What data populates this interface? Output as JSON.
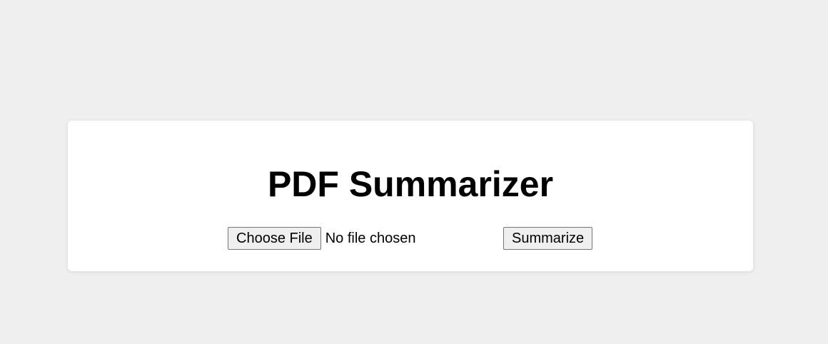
{
  "page": {
    "title": "PDF Summarizer"
  },
  "upload": {
    "choose_label": "Choose File",
    "status": "No file chosen"
  },
  "actions": {
    "submit_label": "Summarize"
  },
  "colors": {
    "page_background": "#efefef",
    "card_background": "#ffffff",
    "button_background": "#efefef",
    "button_border": "#767676",
    "text": "#000000"
  }
}
